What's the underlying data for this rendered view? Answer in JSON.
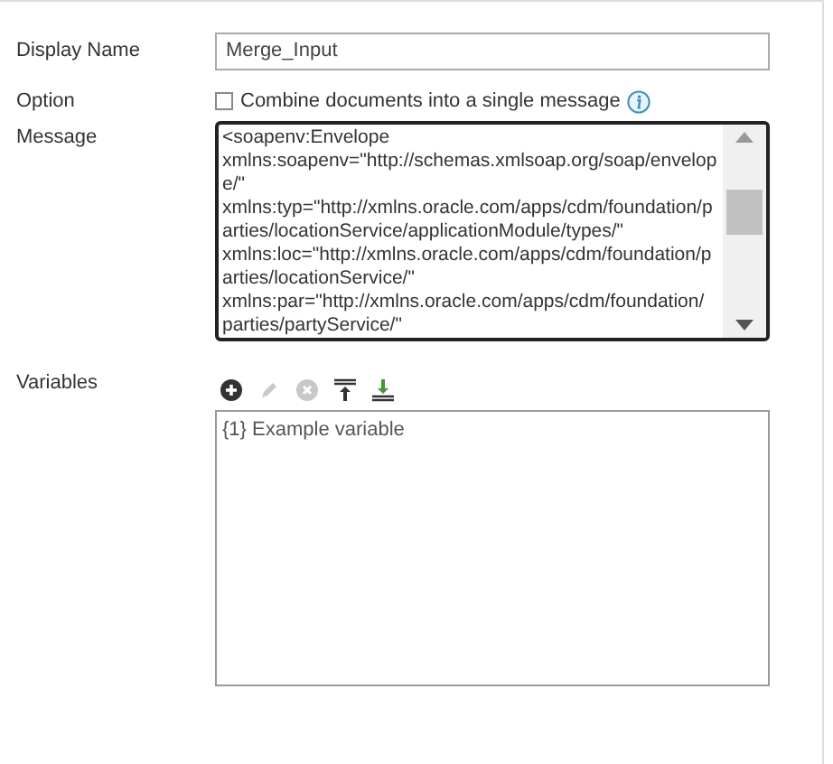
{
  "display_name": {
    "label": "Display Name",
    "value": "Merge_Input"
  },
  "option": {
    "label": "Option",
    "checkbox_label": "Combine documents into a single message",
    "checked": false
  },
  "message": {
    "label": "Message",
    "lines": [
      "<soapenv:Envelope",
      "xmlns:soapenv=\"http://schemas.xmlsoap.org/soap/envelop",
      "e/\"",
      "xmlns:typ=\"http://xmlns.oracle.com/apps/cdm/foundation/p",
      "arties/locationService/applicationModule/types/\"",
      "xmlns:loc=\"http://xmlns.oracle.com/apps/cdm/foundation/p",
      "arties/locationService/\"",
      "xmlns:par=\"http://xmlns.oracle.com/apps/cdm/foundation/",
      "parties/partyService/\""
    ]
  },
  "variables": {
    "label": "Variables",
    "toolbar": [
      {
        "kind": "add",
        "disabled": false
      },
      {
        "kind": "edit",
        "disabled": true
      },
      {
        "kind": "delete",
        "disabled": true
      },
      {
        "kind": "move_top",
        "disabled": false
      },
      {
        "kind": "move_bottom",
        "disabled": false
      }
    ],
    "items": [
      "{1} Example variable"
    ]
  }
}
